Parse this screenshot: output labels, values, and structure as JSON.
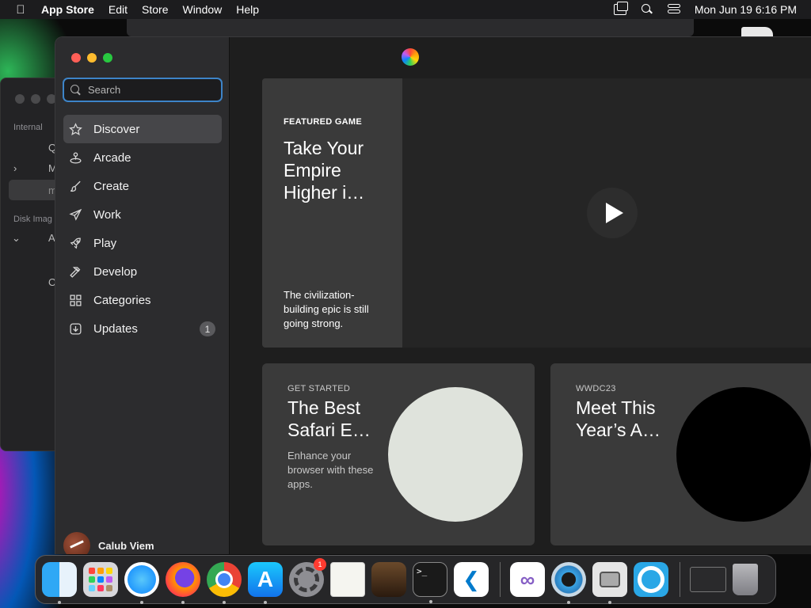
{
  "menubar": {
    "app_name": "App Store",
    "menus": [
      "Edit",
      "Store",
      "Window",
      "Help"
    ],
    "clock": "Mon Jun 19  6:16 PM"
  },
  "background_window": {
    "section_internal": "Internal",
    "section_disk_images": "Disk Imag",
    "fragments": [
      "Q",
      "M",
      "m",
      "A",
      "O"
    ]
  },
  "sidebar": {
    "search_placeholder": "Search",
    "items": [
      {
        "label": "Discover",
        "icon": "star-icon",
        "active": true
      },
      {
        "label": "Arcade",
        "icon": "joystick-icon"
      },
      {
        "label": "Create",
        "icon": "brush-icon"
      },
      {
        "label": "Work",
        "icon": "paper-plane-icon"
      },
      {
        "label": "Play",
        "icon": "rocket-icon"
      },
      {
        "label": "Develop",
        "icon": "hammer-icon"
      },
      {
        "label": "Categories",
        "icon": "grid-icon"
      },
      {
        "label": "Updates",
        "icon": "download-icon",
        "badge": "1"
      }
    ],
    "account_name": "Calub Viem"
  },
  "hero": {
    "kicker": "FEATURED GAME",
    "title": "Take Your Empire Higher i…",
    "description": "The civilization-building epic is still going strong."
  },
  "cards": [
    {
      "kicker": "GET STARTED",
      "title": "The Best Safari E…",
      "description": "Enhance your browser with these apps."
    },
    {
      "kicker": "WWDC23",
      "title": "Meet This Year’s A…",
      "description": ""
    }
  ],
  "dock": {
    "items": [
      "finder-icon",
      "launchpad-icon",
      "safari-icon",
      "firefox-icon",
      "chrome-icon",
      "app-store-icon",
      "system-settings-icon",
      "textedit-icon",
      "instruments-icon",
      "terminal-icon",
      "vscode-icon",
      "visual-studio-icon",
      "quicktime-icon",
      "disk-utility-icon",
      "network-icon",
      "preview-thumbnail",
      "trash-icon"
    ],
    "settings_badge": "1",
    "terminal_glyph": ">_"
  },
  "colors": {
    "accent": "#3d84c8",
    "close": "#ff5f57",
    "minimize": "#febc2e",
    "maximize": "#28c840",
    "badge_red": "#ff3b30"
  }
}
